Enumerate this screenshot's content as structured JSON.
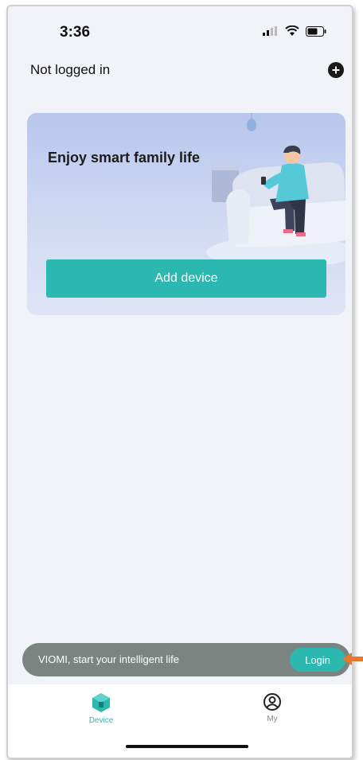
{
  "status_bar": {
    "time": "3:36",
    "icons": [
      "signal-icon",
      "wifi-icon",
      "battery-icon"
    ]
  },
  "header": {
    "title": "Not logged in",
    "add_icon": "plus-circle-icon"
  },
  "promo_card": {
    "title": "Enjoy smart family life",
    "button_label": "Add device"
  },
  "login_banner": {
    "text": "VIOMI, start your intelligent life",
    "button_label": "Login"
  },
  "tabbar": {
    "tabs": [
      {
        "label": "Device",
        "icon": "home-cube-icon",
        "active": true
      },
      {
        "label": "My",
        "icon": "user-icon",
        "active": false
      }
    ]
  },
  "colors": {
    "accent": "#2bb8b0",
    "background": "#f1f3f8",
    "banner": "#7b8481",
    "annotation_arrow": "#e8762b"
  }
}
